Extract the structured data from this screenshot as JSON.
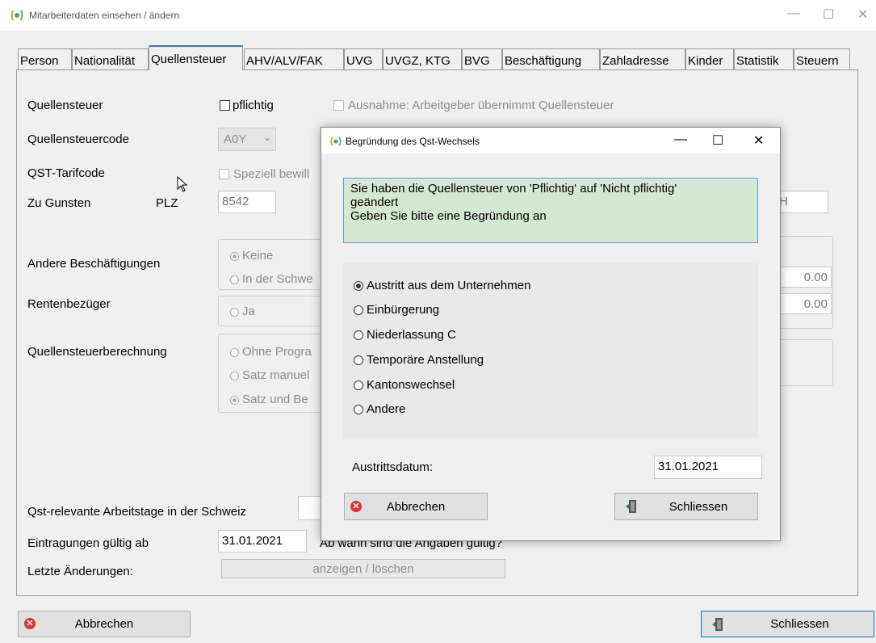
{
  "window": {
    "title": "Mitarbeiterdaten einsehen / ändern"
  },
  "tabs": [
    "Person",
    "Nationalität",
    "Quellensteuer",
    "AHV/ALV/FAK",
    "UVG",
    "UVGZ, KTG",
    "BVG",
    "Beschäftigung",
    "Zahladresse",
    "Kinder",
    "Statistik",
    "Steuern"
  ],
  "form": {
    "quellensteuer_label": "Quellensteuer",
    "pflichtig_label": "pflichtig",
    "ausnahme_label": "Ausnahme: Arbeitgeber übernimmt Quellensteuer",
    "code_label": "Quellensteuercode",
    "code_value": "A0Y",
    "tarif_label": "QST-Tarifcode",
    "speziell_label": "Speziell bewill",
    "zugunsten_label": "Zu Gunsten",
    "plz_label": "PLZ",
    "plz_value": "8542",
    "ch_value": "H",
    "andere_label": "Andere Beschäftigungen",
    "andere_opt1": "Keine",
    "andere_opt2": "In der Schwe",
    "amount1": "0.00",
    "amount2": "0.00",
    "renten_label": "Rentenbezüger",
    "renten_opt": "Ja",
    "berechnung_label": "Quellensteuerberechnung",
    "ber_opt1": "Ohne Progra",
    "ber_opt2": "Satz manuel",
    "ber_opt3": "Satz und Be",
    "arbeitstage_label": "Qst-relevante Arbeitstage in der Schweiz",
    "gueltig_label": "Eintragungen gültig ab",
    "gueltig_value": "31.01.2021",
    "gueltig_hint": "Ab wann sind die Angaben gültig?",
    "letzte_label": "Letzte Änderungen:",
    "anzeigen_label": "anzeigen / löschen"
  },
  "footer": {
    "cancel": "Abbrechen",
    "close": "Schliessen"
  },
  "dialog": {
    "title": "Begründung des Qst-Wechsels",
    "info_line1": "Sie haben die Quellensteuer von 'Pflichtig' auf 'Nicht pflichtig'",
    "info_line2": "geändert",
    "info_line3": "Geben Sie bitte eine Begründung an",
    "options": [
      "Austritt aus dem Unternehmen",
      "Einbürgerung",
      "Niederlassung C",
      "Temporäre Anstellung",
      "Kantonswechsel",
      "Andere"
    ],
    "selected_index": 0,
    "austritt_label": "Austrittsdatum:",
    "austritt_value": "31.01.2021",
    "cancel": "Abbrechen",
    "close": "Schliessen"
  }
}
